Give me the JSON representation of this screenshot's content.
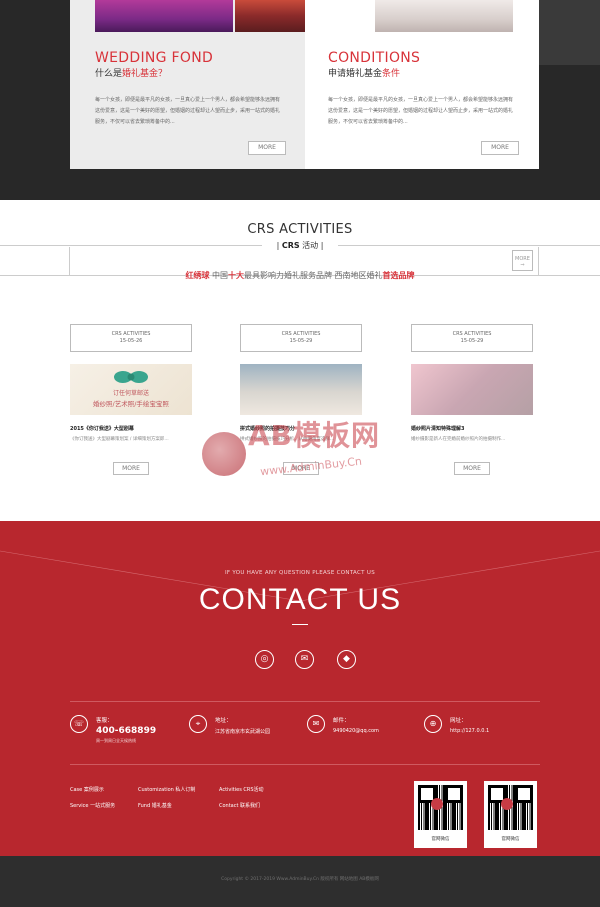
{
  "wedding": {
    "title_en": "WEDDING FOND",
    "title_cn_plain": "什么是",
    "title_cn_highlight": "婚礼基金？",
    "body": "每一个女孩，即便是最平凡的女孩，一旦真心爱上一个男人，都会希望能够永远拥有这份爱意，这是一个美好的愿望，但婚姻的过程却让人望而止步，采用一站式的婚礼服务，不仅可以省去繁琐筹备中的...",
    "more_label": "MORE"
  },
  "conditions": {
    "title_en": "CONDITIONS",
    "title_cn_plain": "申请婚礼基金",
    "title_cn_highlight": "条件",
    "body": "每一个女孩，即便是最平凡的女孩，一旦真心爱上一个男人，都会希望能够永远拥有这份爱意，这是一个美好的愿望，但婚姻的过程却让人望而止步，采用一站式的婚礼服务，不仅可以省去繁琐筹备中的...",
    "more_label": "MORE"
  },
  "activities": {
    "title_en": "CRS ACTIVITIES",
    "sub_bold": "CRS",
    "sub_cn": "活动",
    "more_icon_label": "MORE",
    "tagline": {
      "part1": "红绣球",
      "part2": "中国",
      "part3": "十大",
      "part4": "最具影响力婚礼服务品牌 西南地区婚礼",
      "part5": "首选品牌"
    },
    "posts": [
      {
        "date_label": "CRS ACTIVITIES",
        "date": "15-05-26",
        "image_text_1": "订任何草邮送",
        "image_text_2": "婚纱照/艺术照/手绘宝宝照",
        "title": "2015《你订我送》大型剧幕",
        "desc": "《你订我送》大型剧幕策划案 / 详细策划方案即...",
        "more_label": "MORE"
      },
      {
        "date_label": "CRS ACTIVITIES",
        "date": "15-05-29",
        "title": "拼式婚纱照的拍摄技巧分",
        "desc": "拼式婚纱照的拍摄技巧分析，从拍摄角度选择...",
        "more_label": "MORE"
      },
      {
        "date_label": "CRS ACTIVITIES",
        "date": "15-05-29",
        "title": "婚纱照片清知特殊理解3",
        "desc": "婚纱摄影是新人在完婚前婚纱照片的拍摄制作...",
        "more_label": "MORE"
      }
    ]
  },
  "watermark": {
    "brand": "AB模板网",
    "url": "www.AdminBuy.Cn"
  },
  "contact": {
    "small_heading": "IF YOU HAVE ANY QUESTION PLEASE CONTACT US",
    "heading": "CONTACT US",
    "social": [
      {
        "icon": "weibo-icon",
        "glyph": "◎"
      },
      {
        "icon": "wechat-icon",
        "glyph": "✉"
      },
      {
        "icon": "qq-icon",
        "glyph": "◆"
      }
    ],
    "info": [
      {
        "icon": "phone-icon",
        "glyph": "☏",
        "label": "客服：",
        "value": "400-668899",
        "sub": "周一到周日全天候热线"
      },
      {
        "icon": "location-icon",
        "glyph": "⌖",
        "label": "地址：",
        "value": "江苏省南京市玄武湖公园"
      },
      {
        "icon": "mail-icon",
        "glyph": "✉",
        "label": "邮件：",
        "value": "9490420@qq.com"
      },
      {
        "icon": "globe-icon",
        "glyph": "⊕",
        "label": "网址：",
        "value": "http://127.0.0.1"
      }
    ],
    "links": [
      {
        "en": "Case",
        "cn": "案例展示"
      },
      {
        "en": "Customization",
        "cn": "私人订制"
      },
      {
        "en": "Activities",
        "cn": "CRS活动"
      },
      {
        "en": "Service",
        "cn": "一站式服务"
      },
      {
        "en": "Fund",
        "cn": "婚礼基金"
      },
      {
        "en": "Contact",
        "cn": "联系我们"
      }
    ],
    "qr_codes": [
      {
        "caption": "官网微信"
      },
      {
        "caption": "官网微信"
      }
    ]
  },
  "footer": {
    "copyright": "Copyright © 2017-2019 Www.AdminBuy.Cn 版权所有   网站地图   AB模板网"
  },
  "colors": {
    "accent": "#d8333a",
    "contact_bg": "#b8272e",
    "dark_bg": "#282828",
    "footer_bg": "#2e2e2e"
  }
}
